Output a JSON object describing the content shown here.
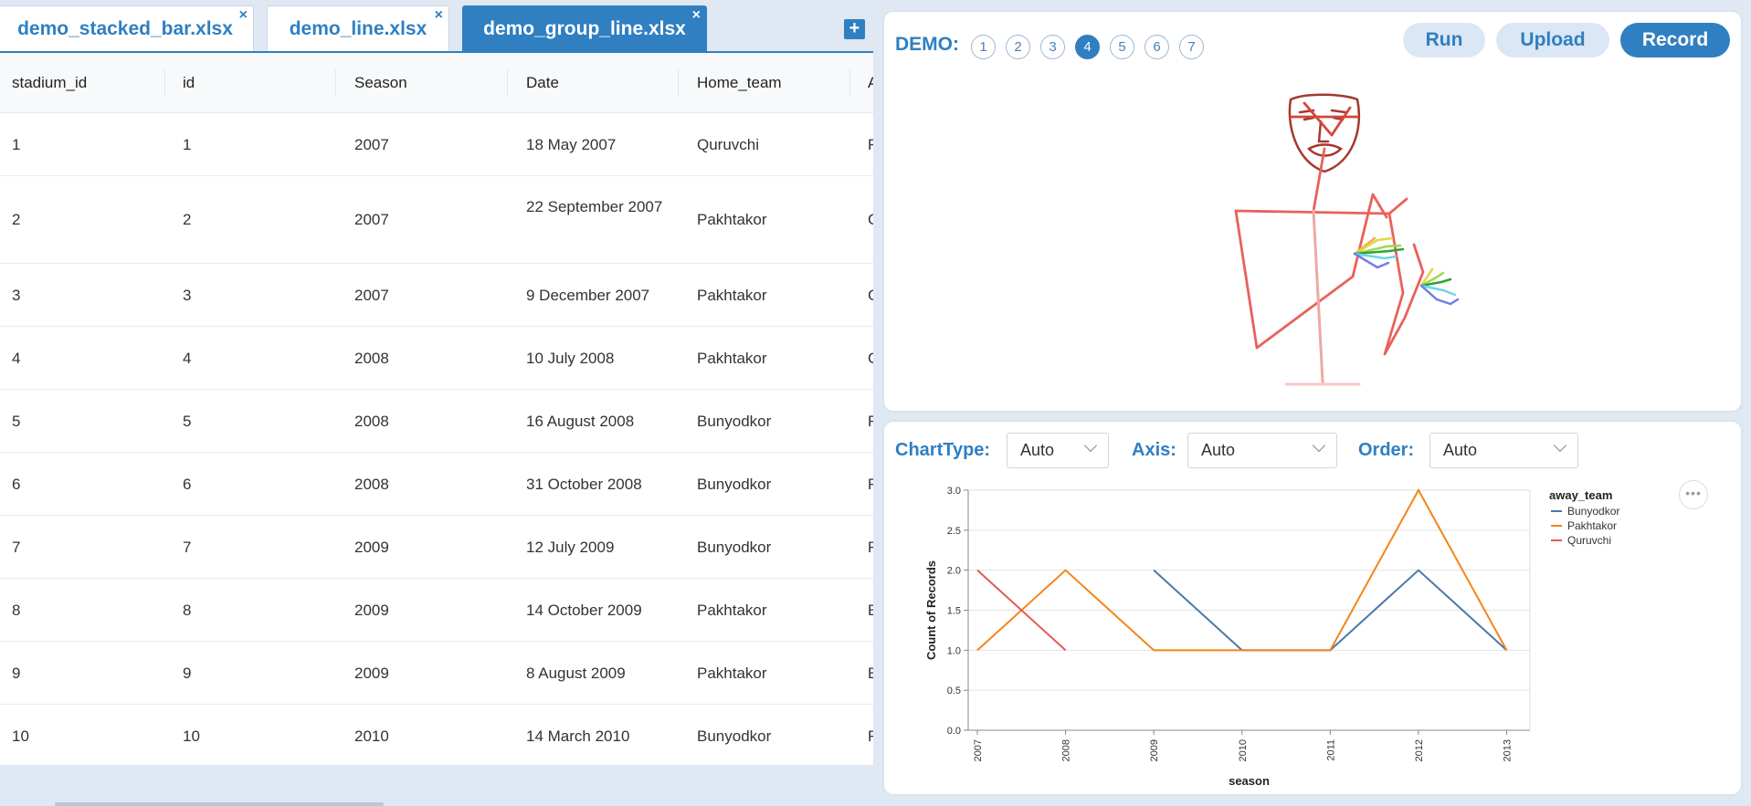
{
  "tabs": [
    {
      "label": "demo_stacked_bar.xlsx",
      "active": false
    },
    {
      "label": "demo_line.xlsx",
      "active": false
    },
    {
      "label": "demo_group_line.xlsx",
      "active": true
    }
  ],
  "tab_close": "×",
  "add_tab": "+",
  "table": {
    "columns": [
      "stadium_id",
      "id",
      "Season",
      "Date",
      "Home_team",
      "A"
    ],
    "rows": [
      [
        "1",
        "1",
        "2007",
        "18 May 2007",
        "Quruvchi",
        "F"
      ],
      [
        "2",
        "2",
        "2007",
        "22 September 2007",
        "Pakhtakor",
        "C"
      ],
      [
        "3",
        "3",
        "2007",
        "9 December 2007",
        "Pakhtakor",
        "C"
      ],
      [
        "4",
        "4",
        "2008",
        "10 July 2008",
        "Pakhtakor",
        "C"
      ],
      [
        "5",
        "5",
        "2008",
        "16 August 2008",
        "Bunyodkor",
        "F"
      ],
      [
        "6",
        "6",
        "2008",
        "31 October 2008",
        "Bunyodkor",
        "F"
      ],
      [
        "7",
        "7",
        "2009",
        "12 July 2009",
        "Bunyodkor",
        "F"
      ],
      [
        "8",
        "8",
        "2009",
        "14 October 2009",
        "Pakhtakor",
        "E"
      ],
      [
        "9",
        "9",
        "2009",
        "8 August 2009",
        "Pakhtakor",
        "E"
      ],
      [
        "10",
        "10",
        "2010",
        "14 March 2010",
        "Bunyodkor",
        "F"
      ]
    ]
  },
  "demo": {
    "label": "DEMO:",
    "numbers": [
      "1",
      "2",
      "3",
      "4",
      "5",
      "6",
      "7"
    ],
    "active_index": 3
  },
  "buttons": {
    "run": "Run",
    "upload": "Upload",
    "record": "Record"
  },
  "controls": {
    "chart_type_label": "ChartType:",
    "chart_type_value": "Auto",
    "axis_label": "Axis:",
    "axis_value": "Auto",
    "order_label": "Order:",
    "order_value": "Auto"
  },
  "more_menu": "•••",
  "colors": {
    "accent": "#2f7fc1",
    "Bunyodkor": "#4c78a8",
    "Pakhtakor": "#f58518",
    "Quruvchi": "#e45756",
    "figure": "#e8625a",
    "face": "#a33a2f"
  },
  "chart_data": {
    "type": "line",
    "xlabel": "season",
    "ylabel": "Count of Records",
    "legend_title": "away_team",
    "legend_position": "right",
    "x": [
      "2007",
      "2008",
      "2009",
      "2010",
      "2011",
      "2012",
      "2013"
    ],
    "ylim": [
      0,
      3
    ],
    "yticks": [
      "0.0",
      "0.5",
      "1.0",
      "1.5",
      "2.0",
      "2.5",
      "3.0"
    ],
    "grid": true,
    "series": [
      {
        "name": "Bunyodkor",
        "points": [
          [
            "2009",
            2
          ],
          [
            "2010",
            1
          ],
          [
            "2011",
            1
          ],
          [
            "2012",
            2
          ],
          [
            "2013",
            1
          ]
        ]
      },
      {
        "name": "Pakhtakor",
        "points": [
          [
            "2007",
            1
          ],
          [
            "2008",
            2
          ],
          [
            "2009",
            1
          ],
          [
            "2010",
            1
          ],
          [
            "2011",
            1
          ],
          [
            "2012",
            3
          ],
          [
            "2013",
            1
          ]
        ]
      },
      {
        "name": "Quruvchi",
        "points": [
          [
            "2007",
            2
          ],
          [
            "2008",
            1
          ]
        ]
      }
    ]
  }
}
